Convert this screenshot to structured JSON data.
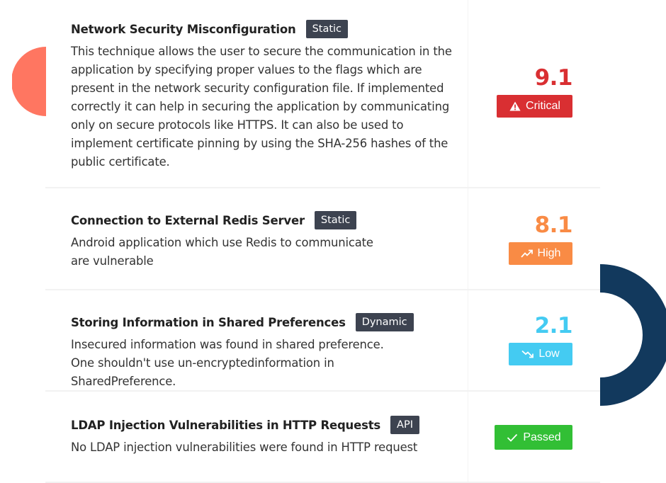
{
  "colors": {
    "critical": "#d92f32",
    "high": "#f98b45",
    "low": "#44cbf2",
    "passed": "#32bf35",
    "badge_bg": "#3d4350",
    "deco_coral": "#ff7661",
    "deco_navy": "#12395d"
  },
  "findings": [
    {
      "title": "Network Security Misconfiguration",
      "type_badge": "Static",
      "description": "This technique allows the user to secure the communication in the application by specifying proper values to the flags which are present in the network security configuration file. If implemented correctly it can help in securing the application by communicating only on secure protocols like HTTPS. It can also be used to implement certificate pinning by using the SHA-256 hashes of the public certificate.",
      "score": "9.1",
      "severity": "Critical",
      "severity_icon": "warning-triangle-icon"
    },
    {
      "title": "Connection to External Redis Server",
      "type_badge": "Static",
      "description": "Android application which use Redis to communicate are vulnerable",
      "score": "8.1",
      "severity": "High",
      "severity_icon": "trending-up-icon"
    },
    {
      "title": "Storing Information in Shared Preferences",
      "type_badge": "Dynamic",
      "description": "Insecured information was found in shared preference. One shouldn't use un-encryptedinformation in SharedPreference.",
      "score": "2.1",
      "severity": "Low",
      "severity_icon": "trending-down-icon"
    },
    {
      "title": "LDAP Injection Vulnerabilities in HTTP Requests",
      "type_badge": "API",
      "description": "No LDAP injection vulnerabilities were found in HTTP request",
      "score": "",
      "severity": "Passed",
      "severity_icon": "check-icon"
    }
  ]
}
